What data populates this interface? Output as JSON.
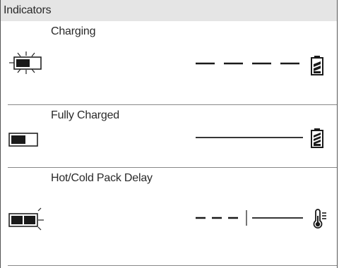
{
  "header": {
    "title": "Indicators"
  },
  "rows": [
    {
      "label": "Charging",
      "indicator": "single-blinking-led-icon",
      "line_style": "dashed",
      "end_icon": "battery-charging-icon"
    },
    {
      "label": "Fully Charged",
      "indicator": "single-solid-led-icon",
      "line_style": "solid",
      "end_icon": "battery-full-icon"
    },
    {
      "label": "Hot/Cold Pack Delay",
      "indicator": "double-blinking-led-icon",
      "line_style": "dashed-then-solid",
      "end_icon": "thermometer-icon"
    }
  ]
}
